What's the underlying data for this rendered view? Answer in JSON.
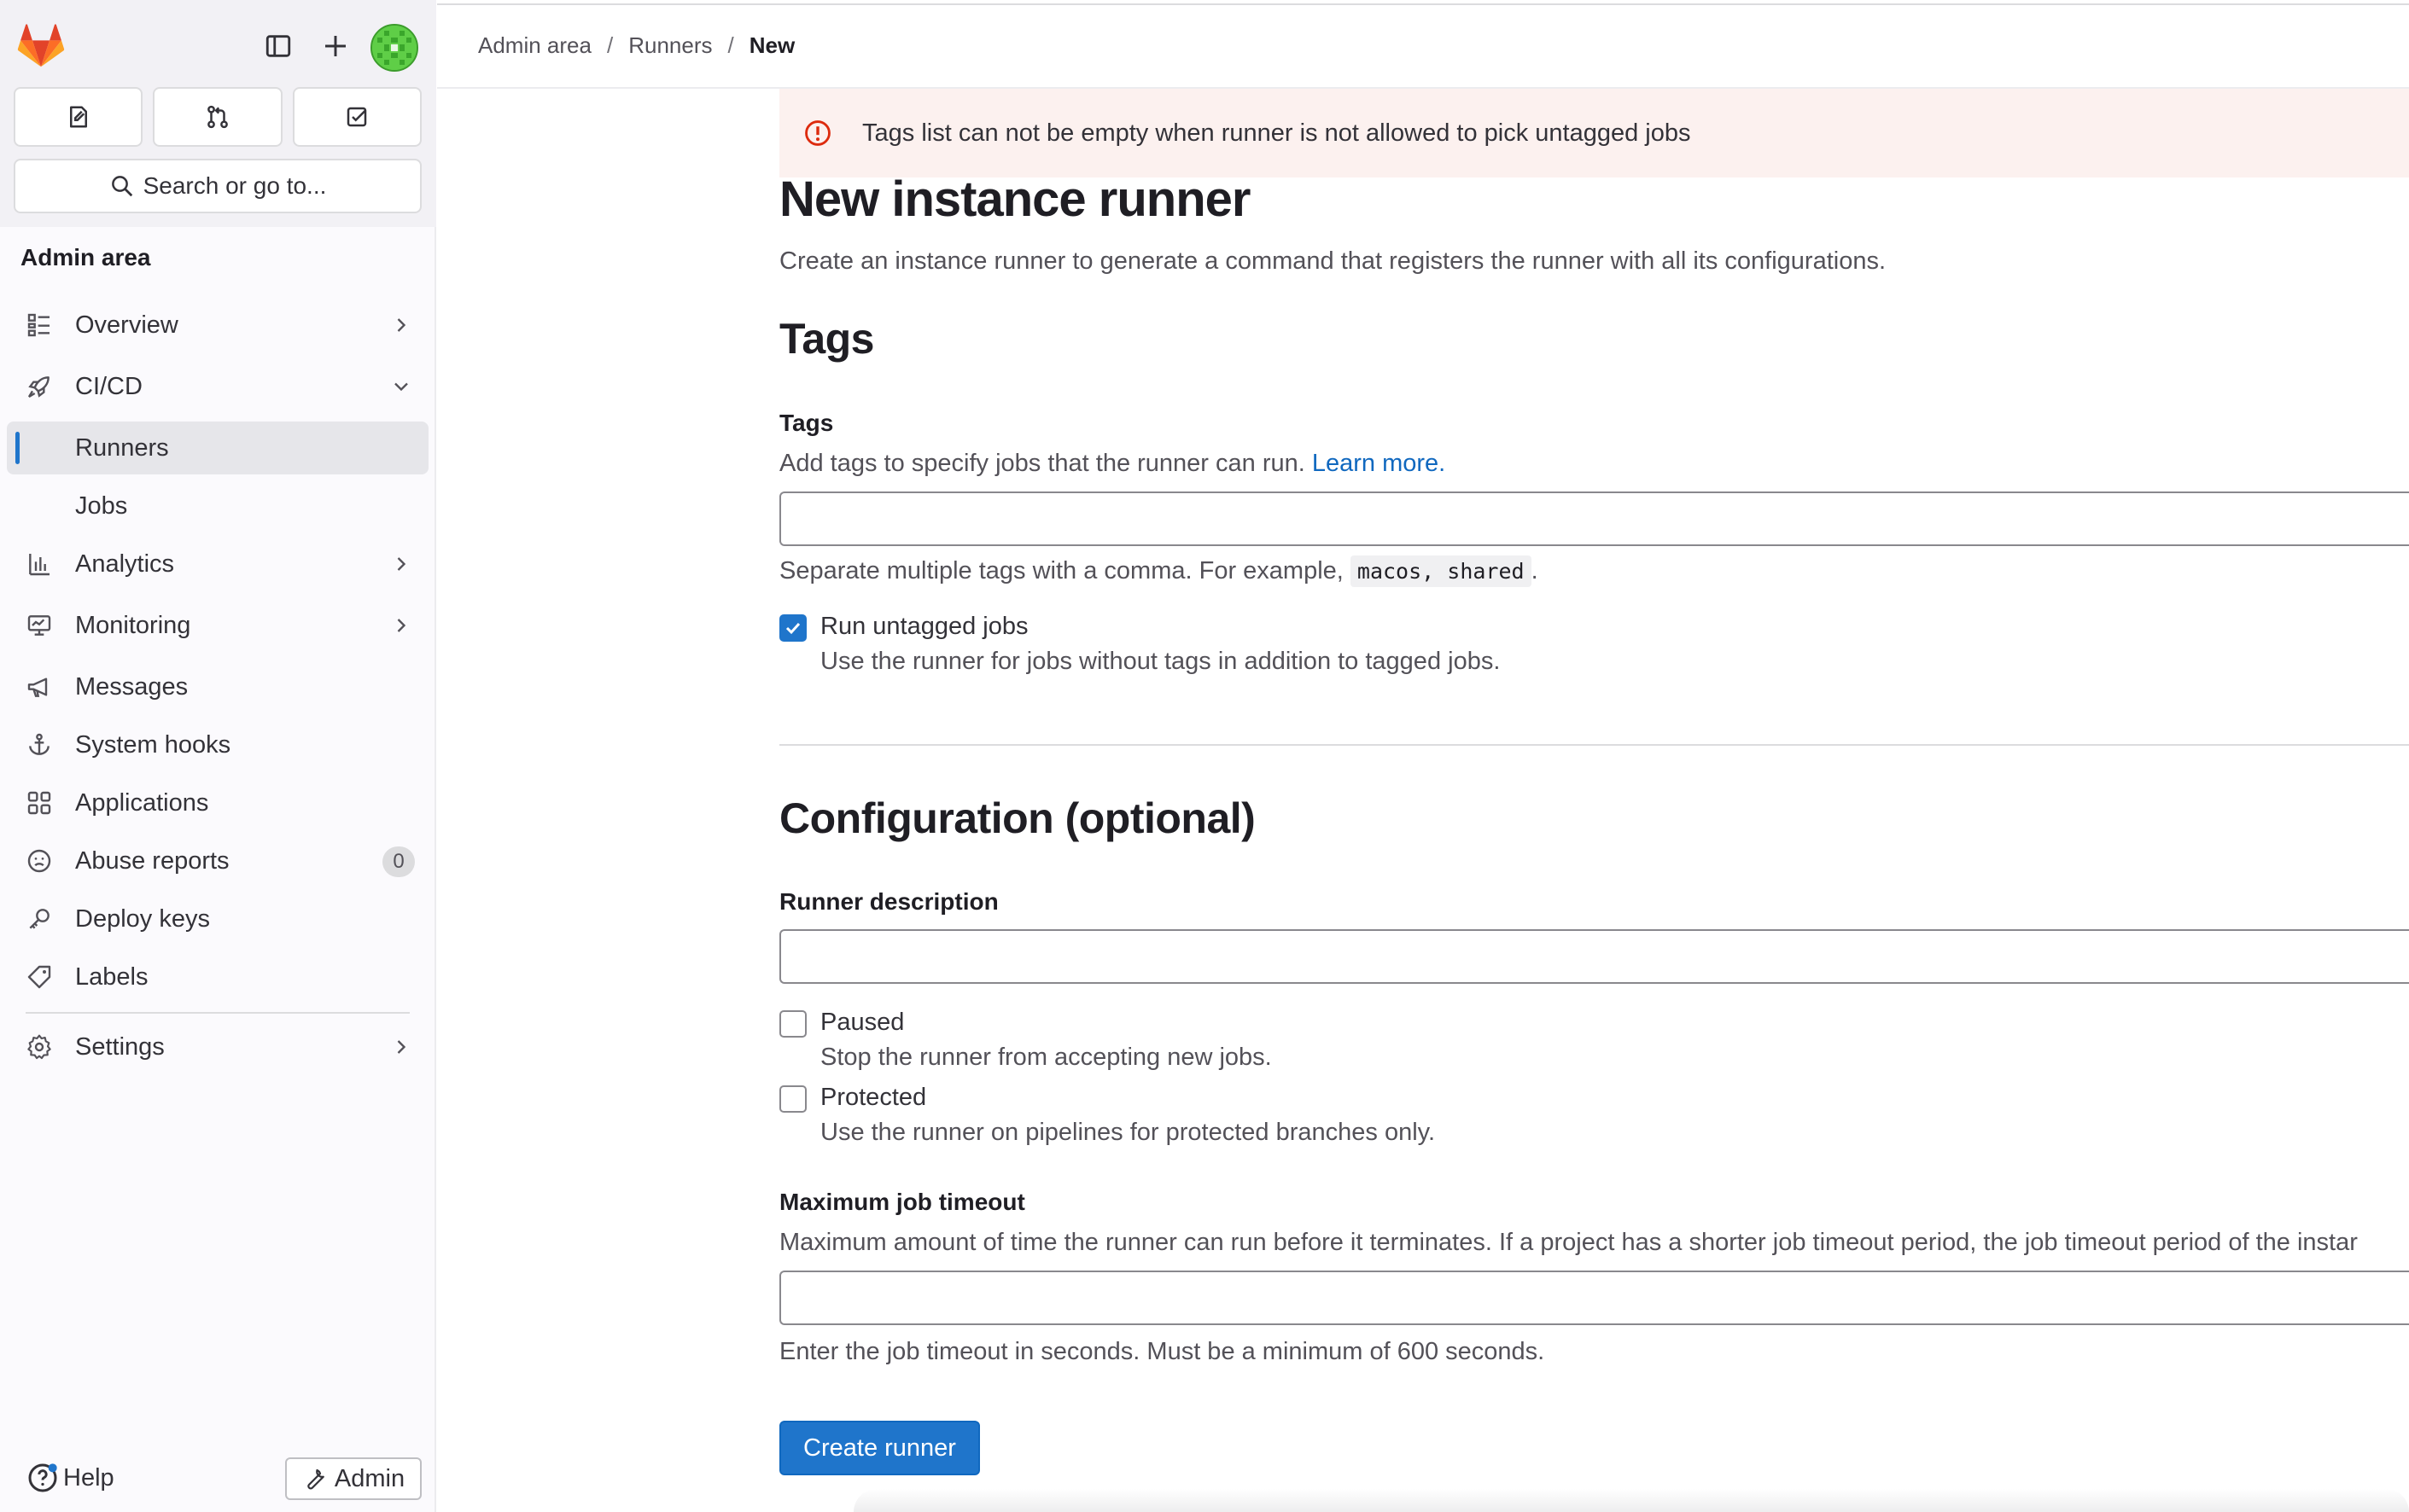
{
  "sidebar": {
    "search_label": "Search or go to...",
    "heading": "Admin area",
    "items": [
      {
        "label": "Overview",
        "icon": "overview-icon"
      },
      {
        "label": "CI/CD",
        "icon": "rocket-icon"
      },
      {
        "label": "Runners"
      },
      {
        "label": "Jobs"
      },
      {
        "label": "Analytics",
        "icon": "chart-icon"
      },
      {
        "label": "Monitoring",
        "icon": "monitor-icon"
      },
      {
        "label": "Messages",
        "icon": "bullhorn-icon"
      },
      {
        "label": "System hooks",
        "icon": "anchor-icon"
      },
      {
        "label": "Applications",
        "icon": "applications-icon"
      },
      {
        "label": "Abuse reports",
        "icon": "abuse-icon",
        "badge": "0"
      },
      {
        "label": "Deploy keys",
        "icon": "key-icon"
      },
      {
        "label": "Labels",
        "icon": "label-icon"
      },
      {
        "label": "Settings",
        "icon": "gear-icon"
      }
    ],
    "help_label": "Help",
    "admin_label": "Admin"
  },
  "breadcrumb": {
    "items": [
      "Admin area",
      "Runners",
      "New"
    ],
    "separator": "/"
  },
  "alert": {
    "text": "Tags list can not be empty when runner is not allowed to pick untagged jobs"
  },
  "page": {
    "title": "New instance runner",
    "lead": "Create an instance runner to generate a command that registers the runner with all its configurations."
  },
  "tags_section": {
    "heading": "Tags",
    "field_label": "Tags",
    "help_prefix": "Add tags to specify jobs that the runner can run. ",
    "help_link": "Learn more.",
    "input_value": "",
    "separator_help_prefix": "Separate multiple tags with a comma. For example, ",
    "separator_help_code": "macos, shared",
    "separator_help_suffix": ".",
    "run_untagged": {
      "label": "Run untagged jobs",
      "description": "Use the runner for jobs without tags in addition to tagged jobs.",
      "checked": true
    }
  },
  "config_section": {
    "heading": "Configuration (optional)",
    "description_label": "Runner description",
    "description_value": "",
    "paused": {
      "label": "Paused",
      "description": "Stop the runner from accepting new jobs.",
      "checked": false
    },
    "protected": {
      "label": "Protected",
      "description": "Use the runner on pipelines for protected branches only.",
      "checked": false
    },
    "timeout_label": "Maximum job timeout",
    "timeout_help": "Maximum amount of time the runner can run before it terminates. If a project has a shorter job timeout period, the job timeout period of the instar",
    "timeout_value": "",
    "timeout_footer": "Enter the job timeout in seconds. Must be a minimum of 600 seconds."
  },
  "actions": {
    "submit_label": "Create runner"
  },
  "colors": {
    "primary": "#1f75cb",
    "link": "#1068bf",
    "alert_bg": "#fcf1ef",
    "alert_icon": "#dd2b0e",
    "avatar": "#5fce47",
    "logo_orange": "#fc6d26"
  }
}
